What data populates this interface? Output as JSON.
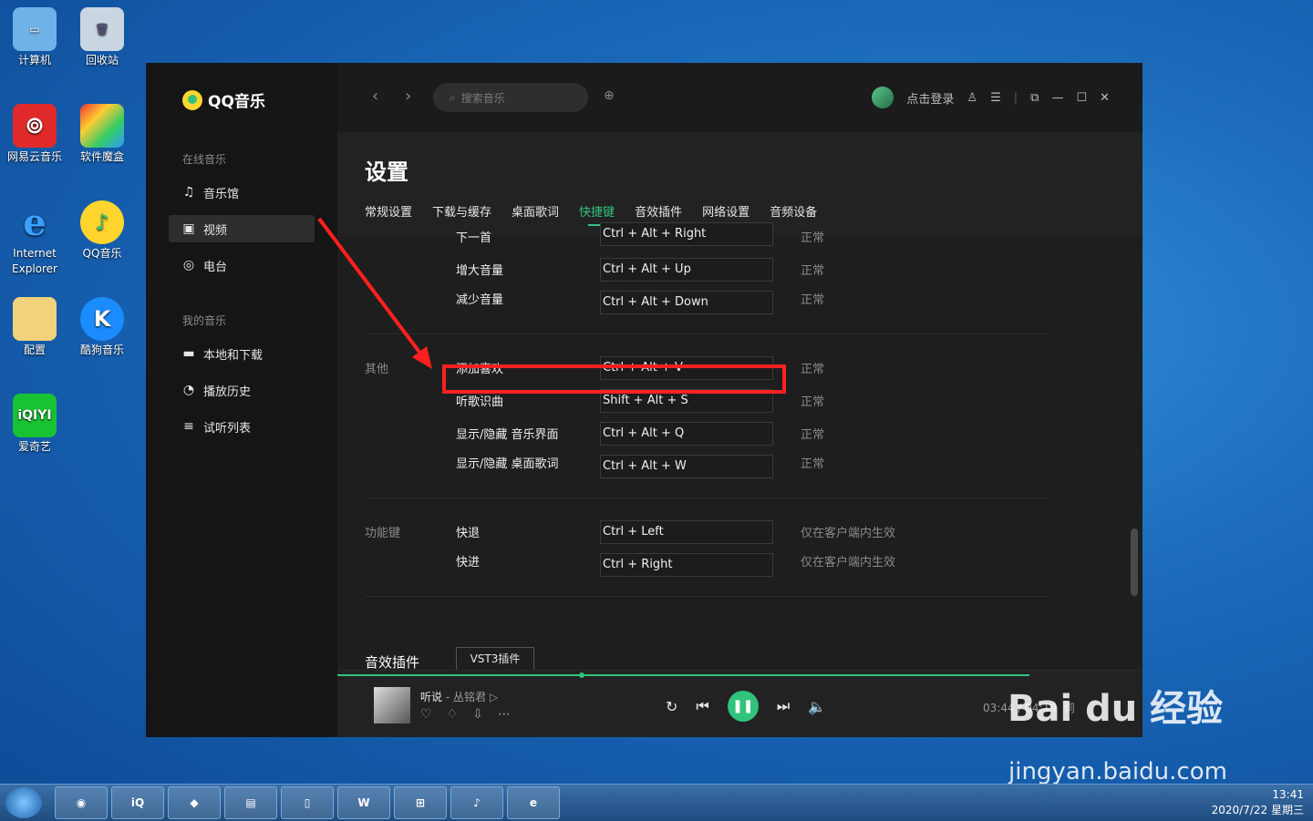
{
  "desktop": {
    "icons": [
      {
        "label": "计算机"
      },
      {
        "label": "回收站"
      },
      {
        "label": "网易云音乐"
      },
      {
        "label": "软件魔盒"
      },
      {
        "label": "Internet Explorer"
      },
      {
        "label": "QQ音乐"
      },
      {
        "label": "配置"
      },
      {
        "label": "酷狗音乐"
      },
      {
        "label": "爱奇艺"
      }
    ]
  },
  "app": {
    "logo": "QQ音乐",
    "sidebar": {
      "group1": "在线音乐",
      "items1": [
        {
          "label": "音乐馆",
          "icon": "music-note-icon"
        },
        {
          "label": "视频",
          "icon": "video-icon"
        },
        {
          "label": "电台",
          "icon": "radio-icon"
        }
      ],
      "group2": "我的音乐",
      "items2": [
        {
          "label": "本地和下载",
          "icon": "monitor-icon"
        },
        {
          "label": "播放历史",
          "icon": "clock-icon"
        },
        {
          "label": "试听列表",
          "icon": "playlist-icon"
        }
      ]
    },
    "topbar": {
      "search_placeholder": "搜索音乐",
      "login": "点击登录"
    },
    "settings": {
      "title": "设置",
      "tabs": [
        "常规设置",
        "下载与缓存",
        "桌面歌词",
        "快捷键",
        "音效插件",
        "网络设置",
        "音频设备"
      ],
      "active_tab": "快捷键",
      "rows_top": [
        {
          "name": "下一首",
          "key": "Ctrl + Alt + Right",
          "status": "正常"
        },
        {
          "name": "增大音量",
          "key": "Ctrl + Alt + Up",
          "status": "正常"
        },
        {
          "name": "减少音量",
          "key": "Ctrl + Alt + Down",
          "status": "正常"
        }
      ],
      "group_other": "其他",
      "rows_other": [
        {
          "name": "添加喜欢",
          "key": "Ctrl + Alt + V",
          "status": "正常"
        },
        {
          "name": "听歌识曲",
          "key": "Shift + Alt + S",
          "status": "正常"
        },
        {
          "name": "显示/隐藏 音乐界面",
          "key": "Ctrl + Alt + Q",
          "status": "正常"
        },
        {
          "name": "显示/隐藏 桌面歌词",
          "key": "Ctrl + Alt + W",
          "status": "正常"
        }
      ],
      "group_func": "功能键",
      "rows_func": [
        {
          "name": "快退",
          "key": "Ctrl + Left",
          "status": "仅在客户端内生效"
        },
        {
          "name": "快进",
          "key": "Ctrl + Right",
          "status": "仅在客户端内生效"
        }
      ],
      "section2": "音效插件",
      "vst_button": "VST3插件"
    },
    "player": {
      "song": "听说",
      "artist": "丛铭君",
      "time": "03:44 / 04:19",
      "lyric": "词",
      "progress": 0.86
    }
  },
  "taskbar": {
    "time": "13:41",
    "date": "2020/7/22 星期三"
  },
  "watermark": {
    "brand": "Bai du 经验",
    "url": "jingyan.baidu.com"
  }
}
